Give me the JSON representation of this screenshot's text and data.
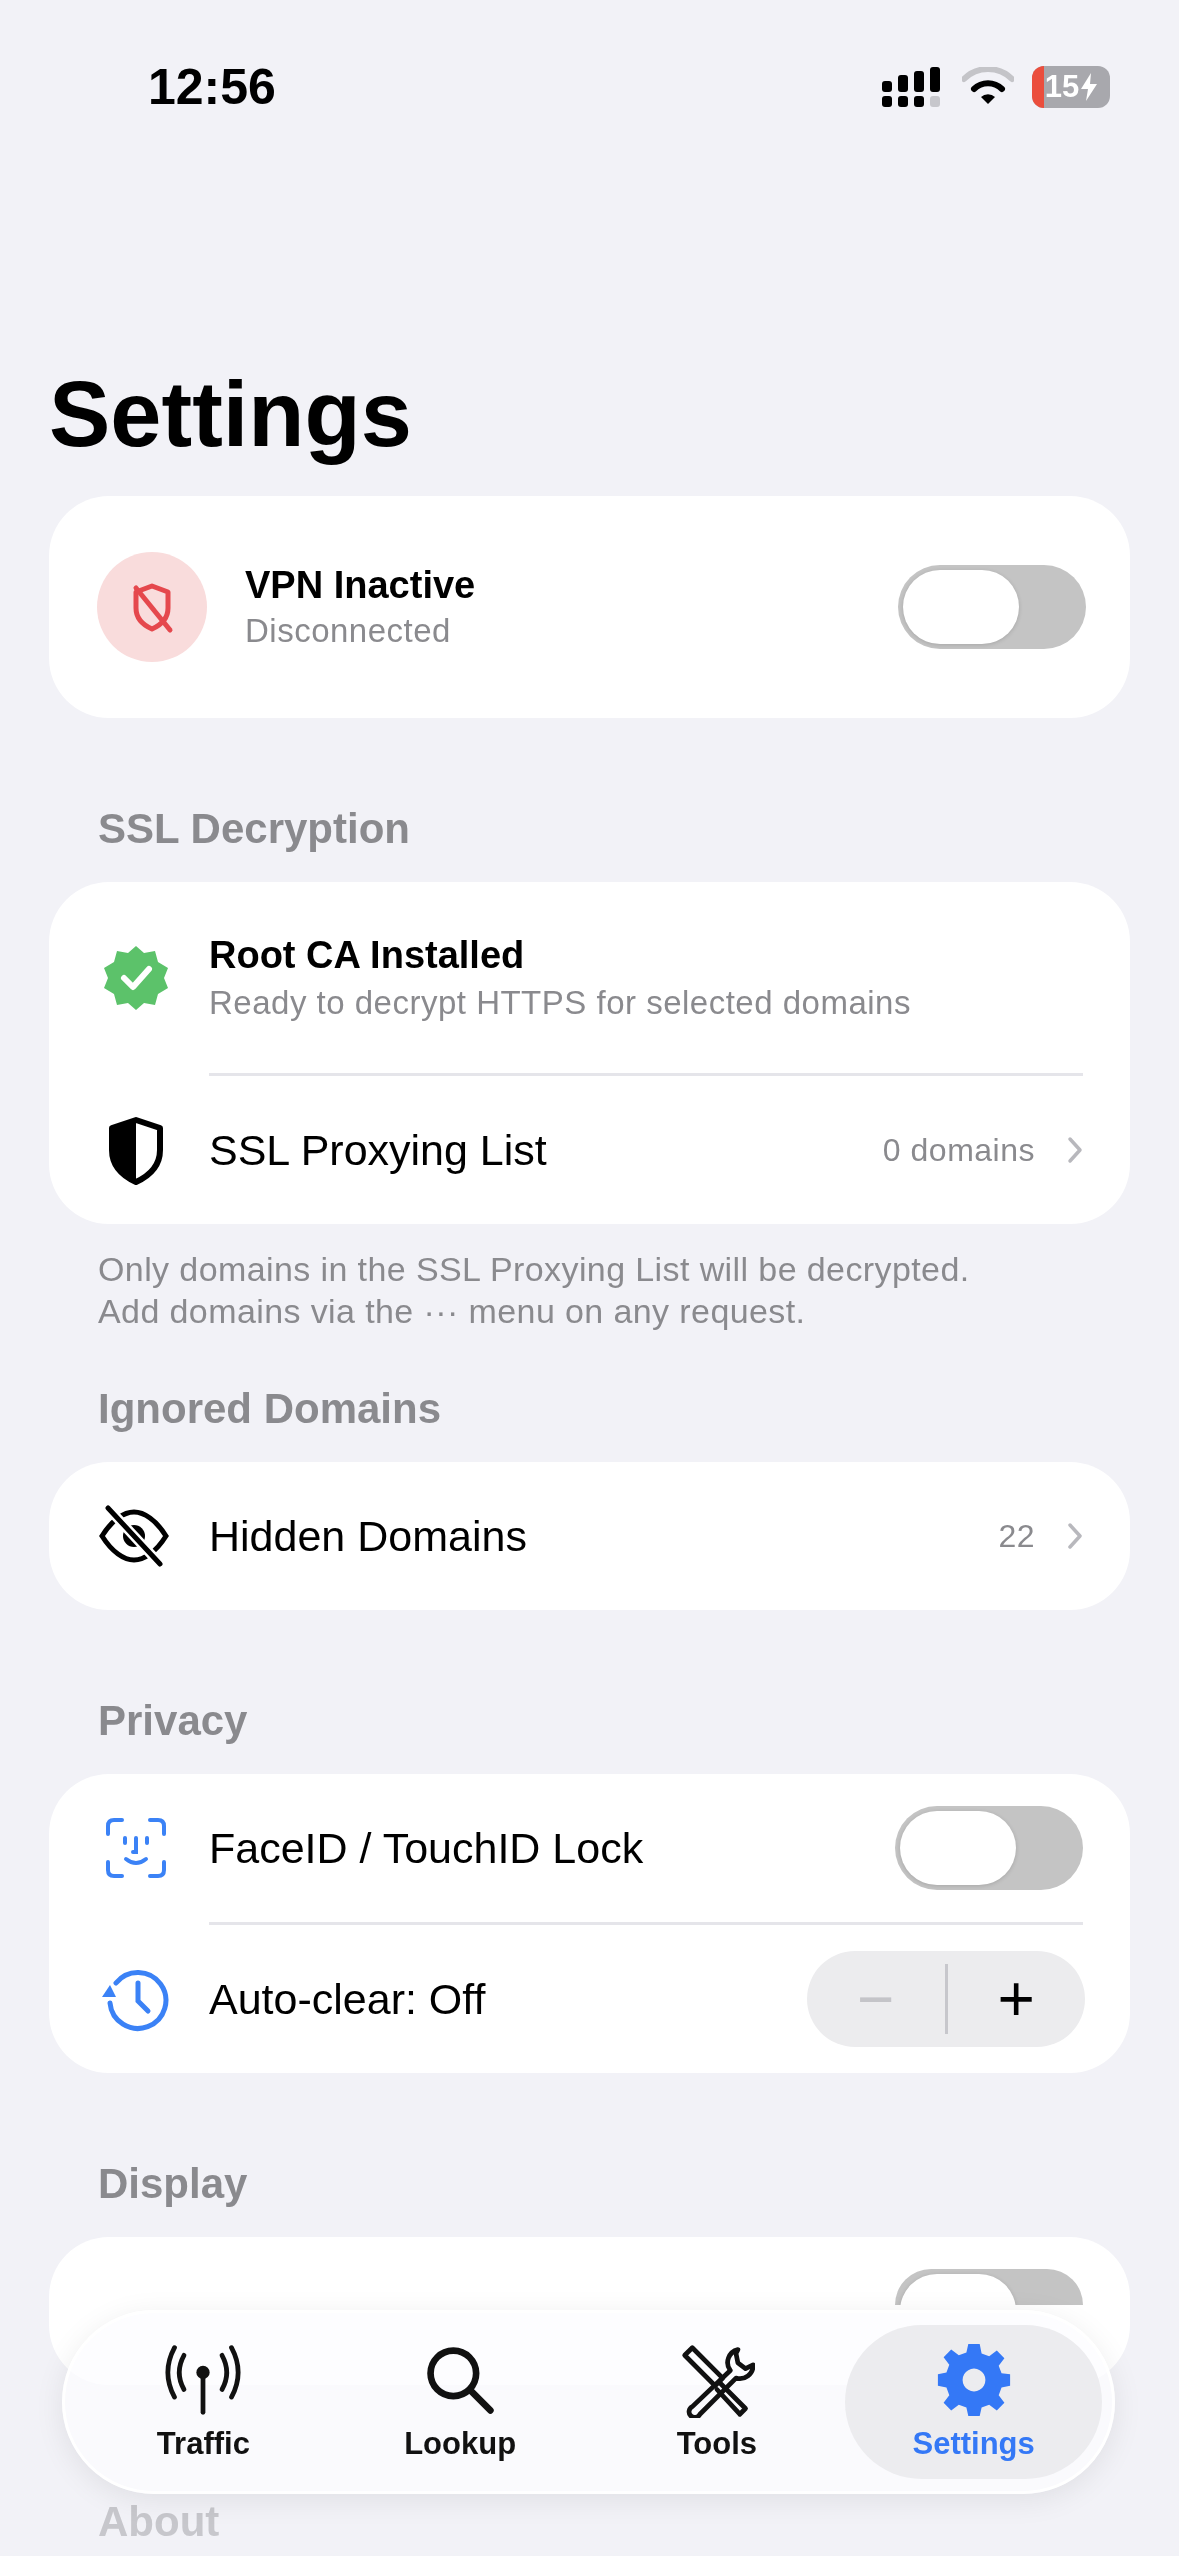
{
  "status_bar": {
    "time": "12:56",
    "battery": "15",
    "low_battery": true,
    "charging": true
  },
  "title": "Settings",
  "vpn": {
    "title": "VPN Inactive",
    "subtitle": "Disconnected",
    "on": false
  },
  "sections": [
    {
      "header": "SSL Decryption",
      "rows": [
        {
          "kind": "status",
          "title": "Root CA Installed",
          "subtitle": "Ready to decrypt HTTPS for selected domains"
        },
        {
          "kind": "link",
          "label": "SSL Proxying List",
          "value": "0 domains"
        }
      ],
      "footer": "Only domains in the SSL Proxying List will be decrypted.\nAdd domains via the ··· menu on any request."
    },
    {
      "header": "Ignored Domains",
      "rows": [
        {
          "kind": "link",
          "label": "Hidden Domains",
          "value": "22"
        }
      ]
    },
    {
      "header": "Privacy",
      "rows": [
        {
          "kind": "toggle",
          "label": "FaceID / TouchID Lock",
          "on": false
        },
        {
          "kind": "stepper",
          "label": "Auto-clear: Off",
          "minus": "−",
          "plus": "+",
          "minus_disabled": true
        }
      ]
    },
    {
      "header": "Display",
      "rows": [
        {
          "kind": "toggle",
          "on": false
        }
      ]
    },
    {
      "header": "About",
      "faded": true
    }
  ],
  "tabs": [
    {
      "label": "Traffic",
      "selected": false
    },
    {
      "label": "Lookup",
      "selected": false
    },
    {
      "label": "Tools",
      "selected": false
    },
    {
      "label": "Settings",
      "selected": true
    }
  ]
}
